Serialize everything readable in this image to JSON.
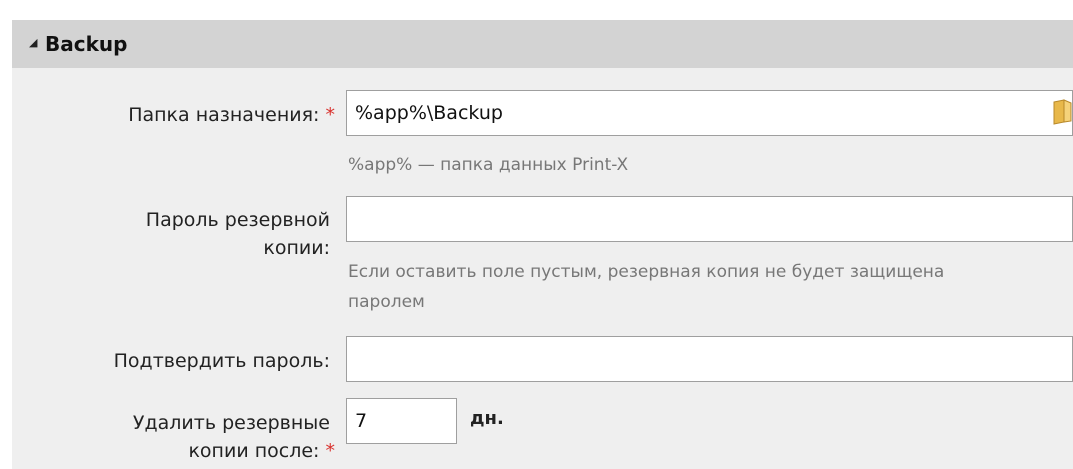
{
  "section": {
    "title": "Backup",
    "collapse_glyph": "◢"
  },
  "destination_folder": {
    "label": "Папка назначения:",
    "required_marker": "*",
    "value": "%app%\\Backup",
    "hint": "%app% — папка данных Print-X",
    "icon": "folder-icon"
  },
  "backup_password": {
    "label_line1": "Пароль резервной",
    "label_line2": "копии:",
    "value": "",
    "hint_line1": "Если оставить поле пустым, резервная копия не будет защищена",
    "hint_line2": "паролем"
  },
  "confirm_password": {
    "label": "Подтвердить пароль:",
    "value": ""
  },
  "delete_after": {
    "label_line1": "Удалить резервные",
    "label_line2": "копии после:",
    "required_marker": "*",
    "value": "7",
    "unit": "дн."
  },
  "colors": {
    "header_bg": "#d3d3d3",
    "panel_bg": "#efefef",
    "required": "#d9322e",
    "hint_text": "#777777",
    "folder_icon": "#e8b84a"
  }
}
